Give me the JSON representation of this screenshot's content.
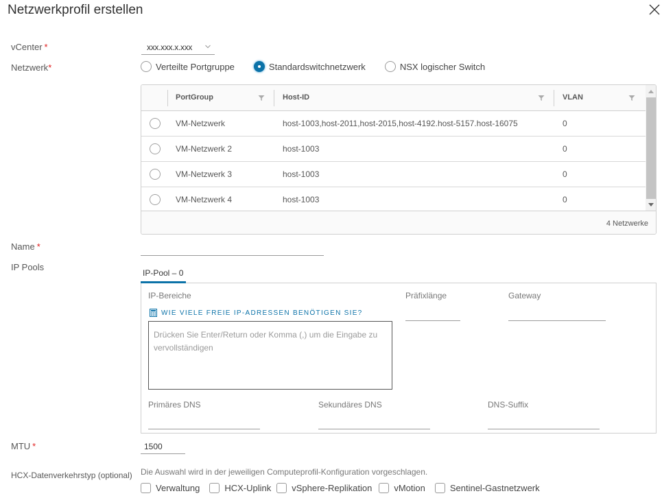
{
  "dialog": {
    "title": "Netzwerkprofil erstellen",
    "close_icon": "close-icon"
  },
  "form": {
    "vcenter": {
      "label": "vCenter",
      "required_mark": "*",
      "value": "xxx.xxx.x.xxx"
    },
    "network": {
      "label": "Netzwerk",
      "required_mark": "*",
      "options": [
        {
          "label": "Verteilte Portgruppe",
          "selected": false
        },
        {
          "label": "Standardswitchnetzwerk",
          "selected": true
        },
        {
          "label": "NSX logischer Switch",
          "selected": false
        }
      ]
    },
    "name": {
      "label": "Name",
      "required_mark": "*",
      "value": ""
    },
    "ip_pools": {
      "label": "IP Pools"
    },
    "mtu": {
      "label": "MTU",
      "required_mark": "*",
      "value": "1500"
    },
    "traffic_type": {
      "label": "HCX-Datenverkehrstyp (optional)",
      "hint": "Die Auswahl wird in der jeweiligen Computeprofil-Konfiguration vorgeschlagen.",
      "options": [
        {
          "label": "Verwaltung",
          "checked": false
        },
        {
          "label": "HCX-Uplink",
          "checked": false
        },
        {
          "label": "vSphere-Replikation",
          "checked": false
        },
        {
          "label": "vMotion",
          "checked": false
        },
        {
          "label": "Sentinel-Gastnetzwerk",
          "checked": false
        }
      ]
    }
  },
  "grid": {
    "columns": [
      "PortGroup",
      "Host-ID",
      "VLAN"
    ],
    "rows": [
      {
        "portgroup": "VM-Netzwerk",
        "host_id": "host-1003,host-2011,host-2015,host-4192.host-5157.host-16075",
        "vlan": "0",
        "selected": false
      },
      {
        "portgroup": "VM-Netzwerk 2",
        "host_id": "host-1003",
        "vlan": "0",
        "selected": false
      },
      {
        "portgroup": "VM-Netzwerk 3",
        "host_id": "host-1003",
        "vlan": "0",
        "selected": false
      },
      {
        "portgroup": "VM-Netzwerk 4",
        "host_id": "host-1003",
        "vlan": "0",
        "selected": false
      }
    ],
    "footer_count": "4 Netzwerke"
  },
  "ip_pool": {
    "tab_label": "IP-Pool – 0",
    "ip_ranges_label": "IP-Bereiche",
    "calc_link": "WIE VIELE FREIE IP-ADRESSEN BENÖTIGEN SIE?",
    "ip_ranges_placeholder": "Drücken Sie Enter/Return oder Komma (,) um die Eingabe zu vervollständigen",
    "prefix_label": "Präfixlänge",
    "gateway_label": "Gateway",
    "primary_dns_label": "Primäres DNS",
    "secondary_dns_label": "Sekundäres DNS",
    "dns_suffix_label": "DNS-Suffix"
  },
  "colors": {
    "accent": "#0b72a8",
    "required": "#e02020"
  }
}
